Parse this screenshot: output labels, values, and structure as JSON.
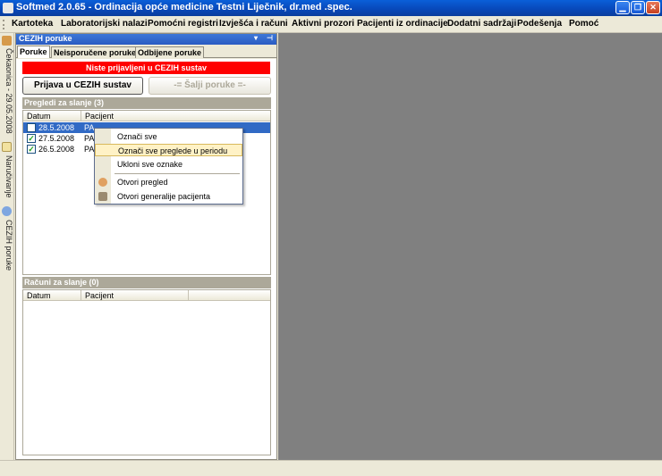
{
  "window": {
    "title": "Softmed 2.0.65 - Ordinacija opće medicine Testni Liječnik, dr.med .spec.",
    "controls": [
      "minimize-icon",
      "maximize-icon",
      "close-icon"
    ]
  },
  "menu": {
    "items": [
      "Kartoteka",
      "Laboratorijski nalazi",
      "Pomoćni registri",
      "Izvješća i računi",
      "Aktivni prozori",
      "Pacijenti iz ordinacije",
      "Dodatni sadržaji",
      "Podešenja",
      "Pomoć"
    ]
  },
  "left_strip": {
    "tabs": [
      "Čekaonica - 29.05.2008",
      "Naručivanje",
      "CEZIH poruke"
    ]
  },
  "panel": {
    "title": "CEZIH poruke",
    "tabs": [
      "Poruke",
      "Neisporučene poruke",
      "Odbijene poruke"
    ],
    "alert": "Niste prijavljeni u CEZIH sustav",
    "login_button": "Prijava u CEZIH sustav",
    "send_button": "-= Šalji poruke =-",
    "exams_section": {
      "title": "Pregledi za slanje (3)",
      "columns": [
        "Datum",
        "Pacijent"
      ],
      "rows": [
        {
          "date": "28.5.2008",
          "patient": "PA",
          "checked": false,
          "selected": true
        },
        {
          "date": "27.5.2008",
          "patient": "PA",
          "checked": true,
          "selected": false
        },
        {
          "date": "26.5.2008",
          "patient": "PA",
          "checked": true,
          "selected": false
        }
      ]
    },
    "invoices_section": {
      "title": "Računi za slanje (0)",
      "columns": [
        "Datum",
        "Pacijent"
      ]
    }
  },
  "context_menu": {
    "items": [
      "Označi sve",
      "Označi sve preglede u periodu",
      "Ukloni sve oznake",
      "Otvori pregled",
      "Otvori generalije pacijenta"
    ],
    "hovered": "Označi sve preglede u periodu"
  },
  "colors": {
    "title_bar": "#0a5fd8",
    "alert_bg": "#ff0000",
    "selection": "#316ac5",
    "mdi_background": "#808080"
  }
}
